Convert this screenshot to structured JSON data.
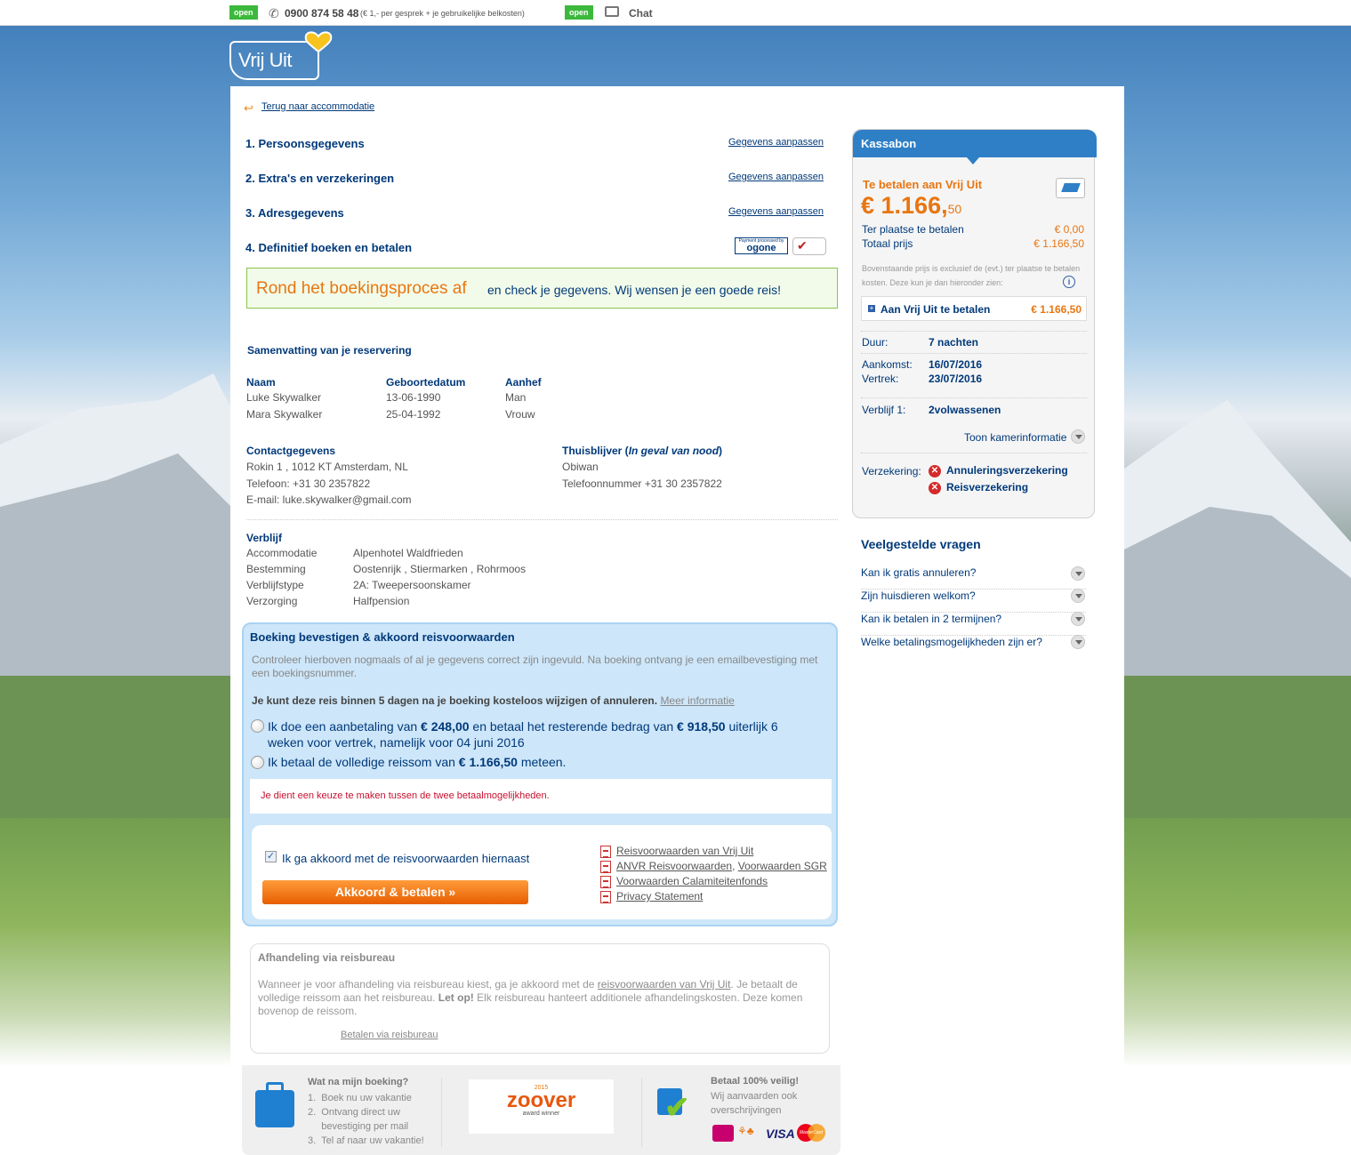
{
  "topbar": {
    "open1": "open",
    "phone": "0900 874 58 48",
    "phone_note": "(€ 1,- per gesprek + je gebruikelijke belkosten)",
    "open2": "open",
    "chat": "Chat"
  },
  "logo": "Vrij Uit",
  "back_link": "Terug naar accommodatie",
  "steps": [
    {
      "label": "1. Persoonsgegevens",
      "link": "Gegevens aanpassen"
    },
    {
      "label": "2. Extra's en verzekeringen",
      "link": "Gegevens aanpassen"
    },
    {
      "label": "3. Adresgegevens",
      "link": "Gegevens aanpassen"
    },
    {
      "label": "4. Definitief boeken en betalen"
    }
  ],
  "ogone": {
    "top": "Payment processed by",
    "name": "ogone"
  },
  "banner": {
    "highlight": "Rond het boekingsproces af",
    "rest": "en check je gegevens. Wij wensen je een goede reis!"
  },
  "summary": {
    "title": "Samenvatting van je reservering",
    "col_headers": [
      "Naam",
      "Geboortedatum",
      "Aanhef"
    ],
    "persons": [
      [
        "Luke Skywalker",
        "13-06-1990",
        "Man"
      ],
      [
        "Mara Skywalker",
        "25-04-1992",
        "Vrouw"
      ]
    ],
    "contact_title": "Contactgegevens",
    "contact": [
      "Rokin 1 , 1012 KT Amsterdam, NL",
      "Telefoon: +31 30 2357822",
      "E-mail: luke.skywalker@gmail.com"
    ],
    "home_title": "Thuisblijver (",
    "home_italic": "In geval van nood",
    "home_close": ")",
    "home": [
      "Obiwan",
      "Telefoonnummer +31 30 2357822"
    ],
    "stay_title": "Verblijf",
    "stay": [
      [
        "Accommodatie",
        "Alpenhotel Waldfrieden"
      ],
      [
        "Bestemming",
        "Oostenrijk , Stiermarken , Rohrmoos"
      ],
      [
        "Verblijfstype",
        "2A: Tweepersoonskamer"
      ],
      [
        "Verzorging",
        "Halfpension"
      ]
    ]
  },
  "confirm": {
    "title": "Boeking bevestigen & akkoord reisvoorwaarden",
    "intro": "Controleer hierboven nogmaals of al je gegevens correct zijn ingevuld. Na boeking ontvang je een emailbevestiging met een boekingsnummer.",
    "free_change": "Je kunt deze reis binnen 5 dagen na je boeking kosteloos wijzigen of annuleren.",
    "more_info": "Meer informatie",
    "option1_a": "Ik doe een aanbetaling van",
    "option1_amount": "€ 248,00",
    "option1_b": "en betaal het resterende bedrag van",
    "option1_rest": "€ 918,50",
    "option1_c": "uiterlijk 6 weken voor vertrek, namelijk voor 04 juni 2016",
    "option2_a": "Ik betaal de volledige reissom van",
    "option2_amount": "€ 1.166,50",
    "option2_b": "meteen.",
    "error": "Je dient een keuze te maken tussen de twee betaalmogelijkheden.",
    "agree": "Ik ga akkoord met de reisvoorwaarden hiernaast",
    "button": "Akkoord & betalen  »",
    "docs": [
      "Reisvoorwaarden van Vrij Uit",
      "ANVR Reisvoorwaarden",
      "Voorwaarden SGR",
      "Voorwaarden Calamiteitenfonds",
      "Privacy Statement"
    ]
  },
  "agency": {
    "title": "Afhandeling via reisbureau",
    "text_a": "Wanneer je voor afhandeling via reisbureau kiest, ga je akkoord met de",
    "text_link": "reisvoorwaarden van Vrij Uit",
    "text_b": ". Je betaalt de volledige reissom aan het reisbureau.",
    "text_bold": "Let op!",
    "text_c": "Elk reisbureau hanteert additionele afhandelingskosten. Deze komen bovenop de reissom.",
    "link": "Betalen via reisbureau"
  },
  "footer": {
    "what_title": "Wat na mijn boeking?",
    "what_items": [
      "Boek nu uw vakantie",
      "Ontvang direct uw bevestiging per mail",
      "Tel af naar uw vakantie!"
    ],
    "zoover_year": "2015",
    "zoover": "zoover",
    "zoover_sub": "award winner",
    "safe_title": "Betaal 100% veilig!",
    "safe_text": "Wij aanvaarden ook overschrijvingen",
    "visa": "VISA",
    "mastercard": "MasterCard"
  },
  "kassabon": {
    "title": "Kassabon",
    "pay_to": "Te betalen aan Vrij Uit",
    "total_main": "€ 1.166,",
    "total_cents": "50",
    "rows": [
      [
        "Ter plaatse te betalen",
        "€ 0,00"
      ],
      [
        "Totaal prijs",
        "€ 1.166,50"
      ]
    ],
    "note": "Bovenstaande prijs is exclusief de (evt.) ter plaatse te betalen kosten. Deze kun je dan hieronder zien:",
    "to_pay_label": "Aan Vrij Uit te betalen",
    "to_pay_value": "€ 1.166,50",
    "duration_label": "Duur:",
    "duration": "7 nachten",
    "arrival_label": "Aankomst:",
    "arrival": "16/07/2016",
    "departure_label": "Vertrek:",
    "departure": "23/07/2016",
    "stay_label": "Verblijf 1:",
    "stay": "2volwassenen",
    "room_info": "Toon kamerinformatie",
    "ins_label": "Verzekering:",
    "insurances": [
      "Annuleringsverzekering",
      "Reisverzekering"
    ]
  },
  "faq": {
    "title": "Veelgestelde vragen",
    "items": [
      "Kan ik gratis annuleren?",
      "Zijn huisdieren welkom?",
      "Kan ik betalen in 2 termijnen?",
      "Welke betalingsmogelijkheden zijn er?"
    ]
  }
}
